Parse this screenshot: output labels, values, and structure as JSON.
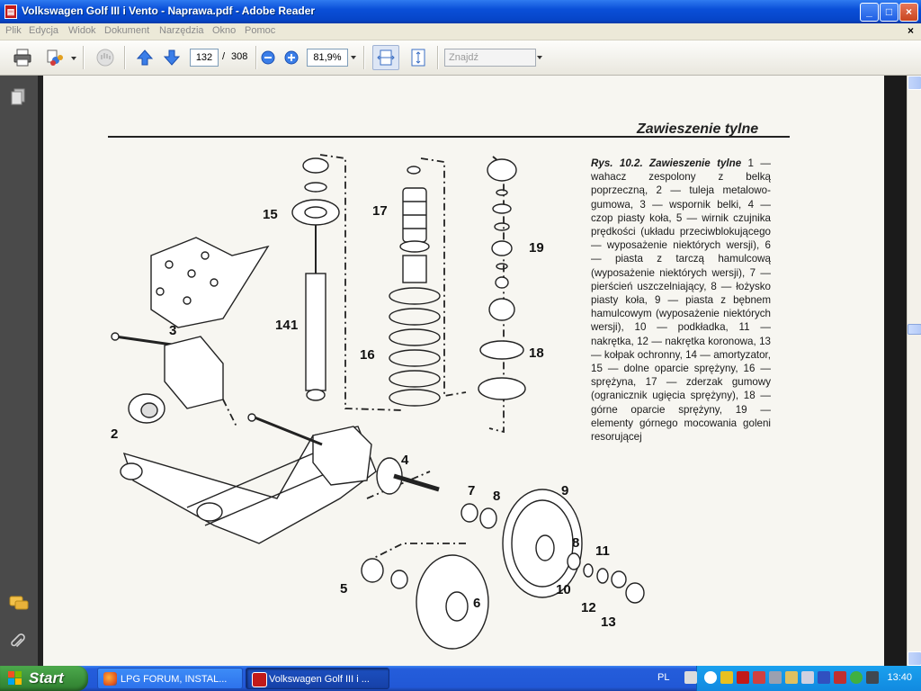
{
  "window": {
    "title": "Volkswagen Golf III i Vento - Naprawa.pdf - Adobe Reader",
    "app_icon": "adobe-reader-icon",
    "buttons": {
      "minimize": "_",
      "maximize": "□",
      "close": "×"
    }
  },
  "menubar": {
    "items": [
      "Plik",
      "Edycja",
      "Widok",
      "Dokument",
      "Narzędzia",
      "Okno",
      "Pomoc"
    ],
    "close_doc": "×"
  },
  "toolbar": {
    "page_current": "132",
    "page_sep": "/",
    "page_total": "308",
    "zoom": "81,9%",
    "search_placeholder": "Znajdź"
  },
  "document": {
    "section_heading": "Zawieszenie tylne",
    "caption_title": "Rys. 10.2. Zawieszenie tylne",
    "caption_body": "1 — wahacz zespolony z belką poprzeczną, 2 — tuleja metalowo-gumowa, 3 — wspornik belki, 4 — czop piasty koła, 5 — wirnik czujnika prędkości (układu przeciwblokującego — wyposażenie niektórych wersji), 6 — piasta z tarczą hamulcową (wyposażenie niektórych wersji), 7 — pierścień uszczelniający, 8 — łożysko piasty koła, 9 — piasta z bębnem hamulcowym (wyposażenie niektórych wersji), 10 — podkładka, 11 — nakrętka, 12 — nakrętka koronowa, 13 — kołpak ochronny, 14 — amortyzator, 15 — dolne oparcie sprężyny, 16 — sprężyna, 17 — zderzak gumowy (ogranicznik ugięcia sprężyny), 18 — górne oparcie sprężyny, 19 — elementy górnego mocowania goleni resorującej",
    "callouts": [
      "1",
      "2",
      "3",
      "4",
      "5",
      "6",
      "7",
      "8",
      "9",
      "8",
      "10",
      "11",
      "12",
      "13",
      "14",
      "15",
      "16",
      "17",
      "18",
      "19"
    ]
  },
  "taskbar": {
    "start_label": "Start",
    "tasks": [
      {
        "label": "LPG FORUM, INSTAL...",
        "icon": "firefox-icon"
      },
      {
        "label": "Volkswagen Golf III i ...",
        "icon": "adobe-reader-icon"
      }
    ],
    "language": "PL",
    "clock": "13:40"
  },
  "colors": {
    "titlebar": "#0a4fd8",
    "start_button": "#3a8f3a",
    "taskbar": "#245ddb",
    "tray": "#118ae0",
    "page": "#f7f6f1"
  }
}
